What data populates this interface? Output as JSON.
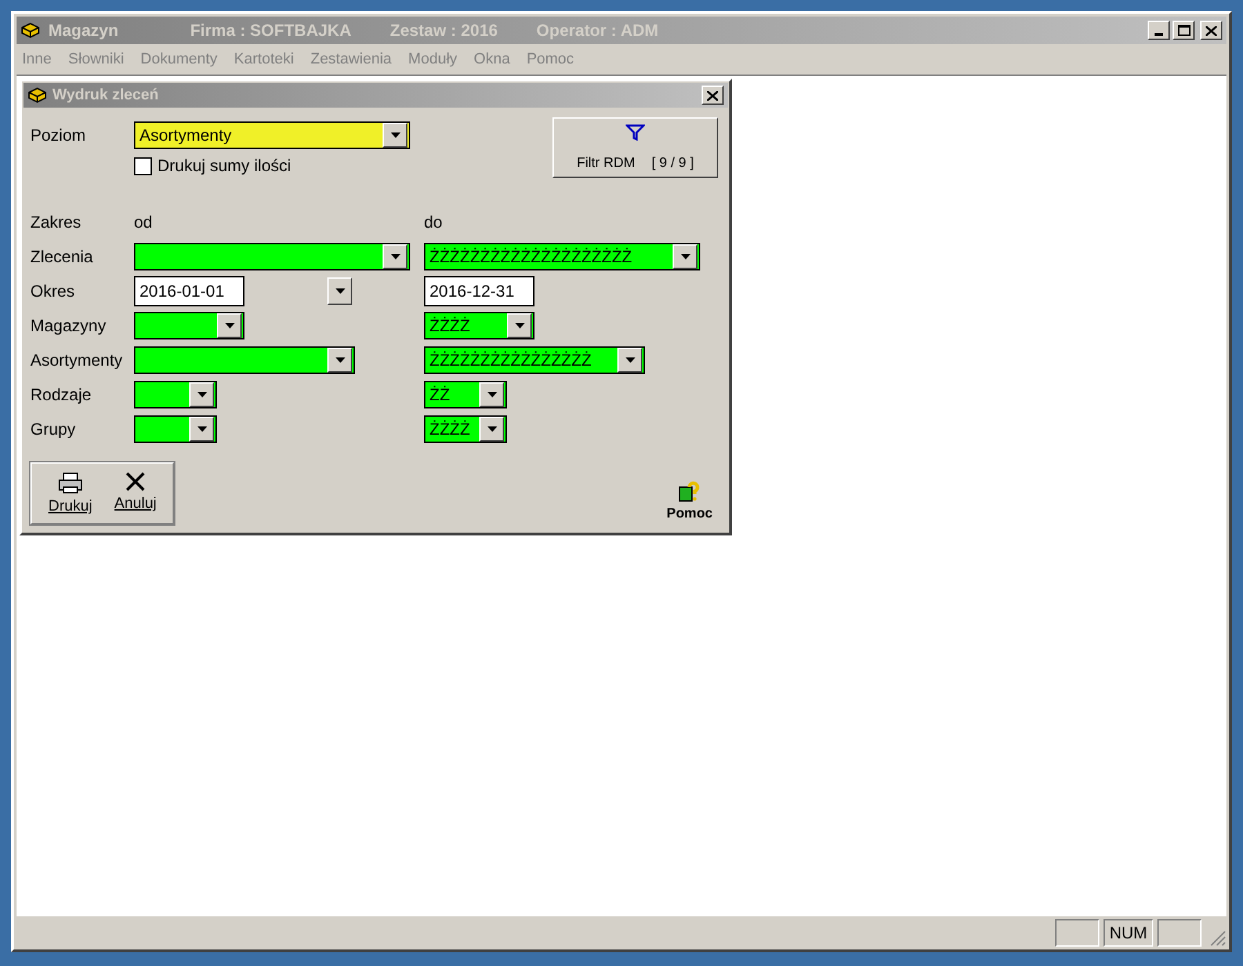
{
  "window": {
    "title": "Magazyn",
    "firma": "Firma : SOFTBAJKA",
    "zestaw": "Zestaw : 2016",
    "operator": "Operator : ADM"
  },
  "menu": [
    "Inne",
    "Słowniki",
    "Dokumenty",
    "Kartoteki",
    "Zestawienia",
    "Moduły",
    "Okna",
    "Pomoc"
  ],
  "dialog": {
    "title": "Wydruk zleceń",
    "poziom": {
      "label": "Poziom",
      "value": "Asortymenty"
    },
    "sum_checkbox": {
      "label": "Drukuj sumy ilości",
      "checked": false
    },
    "filter_button": {
      "label": "Filtr RDM",
      "count": "[ 9 / 9 ]"
    },
    "range_header": {
      "label": "Zakres",
      "from": "od",
      "to": "do"
    },
    "rows": [
      {
        "label": "Zlecenia",
        "kind": "combo",
        "to": "ŻŻŻŻŻŻŻŻŻŻŻŻŻŻŻŻŻŻŻŻ"
      },
      {
        "label": "Okres",
        "kind": "date",
        "from": "2016-01-01",
        "to": "2016-12-31"
      },
      {
        "label": "Magazyny",
        "kind": "combo",
        "to": "ŻŻŻŻ"
      },
      {
        "label": "Asortymenty",
        "kind": "combo",
        "to": "ŻŻŻŻŻŻŻŻŻŻŻŻŻŻŻŻ"
      },
      {
        "label": "Rodzaje",
        "kind": "combo",
        "to": "ŻŻ"
      },
      {
        "label": "Grupy",
        "kind": "combo",
        "to": "ŻŻŻŻ"
      }
    ],
    "buttons": [
      {
        "label": "Drukuj",
        "kind": "print"
      },
      {
        "label": "Anuluj",
        "kind": "cancel"
      }
    ],
    "help_button": {
      "label": "Pomoc"
    }
  },
  "status_bar": {
    "num_indicator": "NUM"
  }
}
